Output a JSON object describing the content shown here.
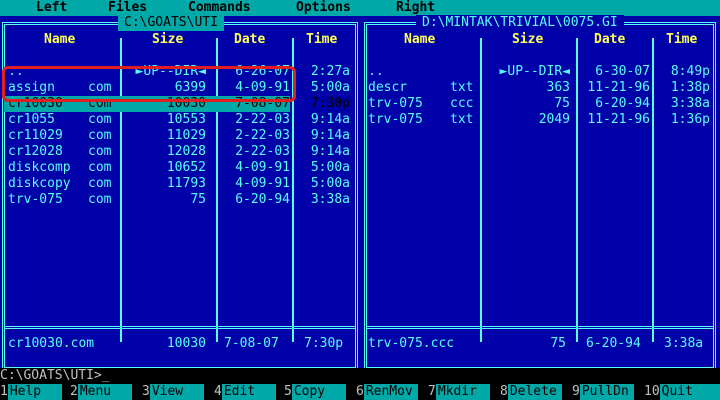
{
  "menu": [
    "Left",
    "Files",
    "Commands",
    "Options",
    "Right"
  ],
  "left_panel": {
    "title": "C:\\GOATS\\UTI",
    "headers": {
      "name": "Name",
      "size": "Size",
      "date": "Date",
      "time": "Time"
    },
    "files": [
      {
        "name": "..",
        "ext": "",
        "size": "►UP--DIR◄",
        "date": "6-26-07",
        "time": "2:27a"
      },
      {
        "name": "assign",
        "ext": "com",
        "size": "6399",
        "date": "4-09-91",
        "time": "5:00a"
      },
      {
        "name": "cr10030",
        "ext": "com",
        "size": "10030",
        "date": "7-08-07",
        "time": "7:30p"
      },
      {
        "name": "cr1055",
        "ext": "com",
        "size": "10553",
        "date": "2-22-03",
        "time": "9:14a"
      },
      {
        "name": "cr11029",
        "ext": "com",
        "size": "11029",
        "date": "2-22-03",
        "time": "9:14a"
      },
      {
        "name": "cr12028",
        "ext": "com",
        "size": "12028",
        "date": "2-22-03",
        "time": "9:14a"
      },
      {
        "name": "diskcomp",
        "ext": "com",
        "size": "10652",
        "date": "4-09-91",
        "time": "5:00a"
      },
      {
        "name": "diskcopy",
        "ext": "com",
        "size": "11793",
        "date": "4-09-91",
        "time": "5:00a"
      },
      {
        "name": "trv-075",
        "ext": "com",
        "size": "75",
        "date": "6-20-94",
        "time": "3:38a"
      }
    ],
    "selected_index": 2,
    "status": {
      "name": "cr10030.com",
      "size": "10030",
      "date": "7-08-07",
      "time": "7:30p"
    }
  },
  "right_panel": {
    "title": "D:\\MINTAK\\TRIVIAL\\0075.GI",
    "headers": {
      "name": "Name",
      "size": "Size",
      "date": "Date",
      "time": "Time"
    },
    "files": [
      {
        "name": "..",
        "ext": "",
        "size": "►UP--DIR◄",
        "date": "6-30-07",
        "time": "8:49p"
      },
      {
        "name": "descr",
        "ext": "txt",
        "size": "363",
        "date": "11-21-96",
        "time": "1:38p"
      },
      {
        "name": "trv-075",
        "ext": "ccc",
        "size": "75",
        "date": "6-20-94",
        "time": "3:38a"
      },
      {
        "name": "trv-075",
        "ext": "txt",
        "size": "2049",
        "date": "11-21-96",
        "time": "1:36p"
      }
    ],
    "status": {
      "name": "trv-075.ccc",
      "size": "75",
      "date": "6-20-94",
      "time": "3:38a"
    }
  },
  "command_line": "C:\\GOATS\\UTI>_",
  "keybar": [
    {
      "num": "1",
      "label": "Help"
    },
    {
      "num": "2",
      "label": "Menu"
    },
    {
      "num": "3",
      "label": "View"
    },
    {
      "num": "4",
      "label": "Edit"
    },
    {
      "num": "5",
      "label": "Copy"
    },
    {
      "num": "6",
      "label": "RenMov"
    },
    {
      "num": "7",
      "label": "Mkdir"
    },
    {
      "num": "8",
      "label": "Delete"
    },
    {
      "num": "9",
      "label": "PullDn"
    },
    {
      "num": "10",
      "label": "Quit"
    }
  ],
  "colors": {
    "panel_bg": "#0000a8",
    "text": "#55ffff",
    "header": "#ffff55",
    "selection": "#00a8a8",
    "highlight_ring": "#e02020"
  }
}
